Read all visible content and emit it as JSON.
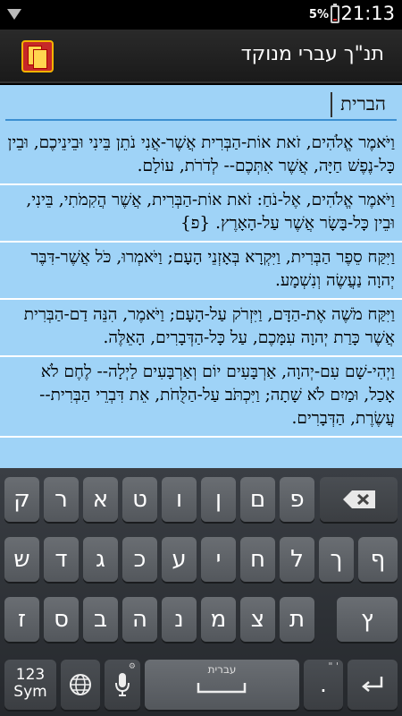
{
  "status_bar": {
    "battery": "5%",
    "time": "21:13"
  },
  "app": {
    "title": "תנ\"ך עברי מנוקד"
  },
  "search": {
    "value": "הברית"
  },
  "verses": [
    "וַיֹּאמֶר אֱלֹהִים, זֹאת אוֹת-הַבְּרִית אֲשֶׁר-אֲנִי נֹתֵן בֵּינִי וּבֵינֵיכֶם, וּבֵין כָּל-נֶפֶשׁ חַיָּה, אֲשֶׁר אִתְּכֶם-- לְדֹרֹת, עוֹלָם.",
    "וַיֹּאמֶר אֱלֹהִים, אֶל-נֹחַ: זֹאת אוֹת-הַבְּרִית, אֲשֶׁר הֲקִמֹתִי, בֵּינִי, וּבֵין כָּל-בָּשָׂר אֲשֶׁר עַל-הָאָרֶץ. {פ}",
    "וַיִּקַּח סֵפֶר הַבְּרִית, וַיִּקְרָא בְּאָזְנֵי הָעָם; וַיֹּאמְרוּ, כֹּל אֲשֶׁר-דִּבֶּר יְהוָה נַעֲשֶׂה וְנִשְׁמָע.",
    "וַיִּקַּח מֹשֶׁה אֶת-הַדָּם, וַיִּזְרֹק עַל-הָעָם; וַיֹּאמֶר, הִנֵּה דַם-הַבְּרִית אֲשֶׁר כָּרַת יְהוָה עִמָּכֶם, עַל כָּל-הַדְּבָרִים, הָאֵלֶּה.",
    "וַיְהִי-שָׁם עִם-יְהוָה, אַרְבָּעִים יוֹם וְאַרְבָּעִים לַיְלָה-- לֶחֶם לֹא אָכַל, וּמַיִם לֹא שָׁתָה; וַיִּכְתֹּב עַל-הַלֻּחֹת, אֵת דִּבְרֵי הַבְּרִית--עֲשֶׂרֶת, הַדְּבָרִים."
  ],
  "keyboard": {
    "row1": [
      "ק",
      "ר",
      "א",
      "ט",
      "ו",
      "ן",
      "ם",
      "פ"
    ],
    "row2": [
      "ש",
      "ד",
      "ג",
      "כ",
      "ע",
      "י",
      "ח",
      "ל",
      "ך",
      "ף"
    ],
    "row3": [
      "ז",
      "ס",
      "ב",
      "ה",
      "נ",
      "מ",
      "צ",
      "ת",
      "ץ"
    ],
    "sym_label": "123\nSym",
    "space_label": "עברית",
    "space_indicator": "– –",
    "icons": [
      "backspace-icon",
      "globe-icon",
      "mic-icon",
      "enter-icon"
    ]
  }
}
